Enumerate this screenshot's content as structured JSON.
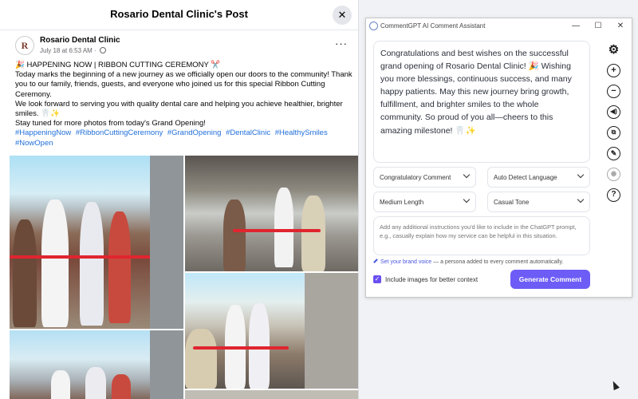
{
  "facebook": {
    "modal_title": "Rosario Dental Clinic's Post",
    "author_name": "Rosario Dental Clinic",
    "avatar_letter": "R",
    "post_meta": "July 18 at 6:53 AM · ",
    "post_lines": [
      "🎉 HAPPENING NOW | RIBBON CUTTING CEREMONY ✂️",
      "Today marks the beginning of a new journey as we officially open our doors to the community! Thank you to our family, friends, guests, and everyone who joined us for this special Ribbon Cutting Ceremony.",
      "We look forward to serving you with quality dental care and helping you achieve healthier, brighter smiles. 🦷✨",
      "Stay tuned for more photos from today's Grand Opening!"
    ],
    "hashtags": [
      "#HappeningNow",
      "#RibbonCuttingCeremony",
      "#GrandOpening",
      "#DentalClinic",
      "#HealthySmiles",
      "#NowOpen"
    ],
    "close_icon": "close-icon",
    "more_icon": "ellipsis-icon"
  },
  "commentgpt": {
    "window_title": "CommentGPT AI Comment Assistant",
    "generated_comment": "Congratulations and best wishes on the successful grand opening of Rosario Dental Clinic! 🎉 Wishing you more blessings, continuous success, and many happy patients. May this new journey bring growth, fulfillment, and brighter smiles to the whole community. So proud of you all—cheers to this amazing milestone! 🦷✨",
    "selects": {
      "comment_type": "Congratulatory Comment",
      "language": "Auto Detect Language",
      "length": "Medium Length",
      "tone": "Casual Tone"
    },
    "instructions_placeholder": "Add any additional instructions you'd like to include in the ChatGPT prompt, e.g., casually explain how my service can be helpful in this situation.",
    "brand_voice_link": "Set your brand voice",
    "brand_voice_desc": " — a persona added to every comment automatically.",
    "include_images_label": "Include images for better context",
    "include_images_checked": true,
    "generate_button": "Generate Comment",
    "side_icons": [
      "gear-icon",
      "plus-icon",
      "minus-icon",
      "speaker-icon",
      "copy-icon",
      "pencil-icon",
      "settings-badge-icon",
      "help-icon"
    ],
    "accent_color": "#6d5cf6"
  }
}
